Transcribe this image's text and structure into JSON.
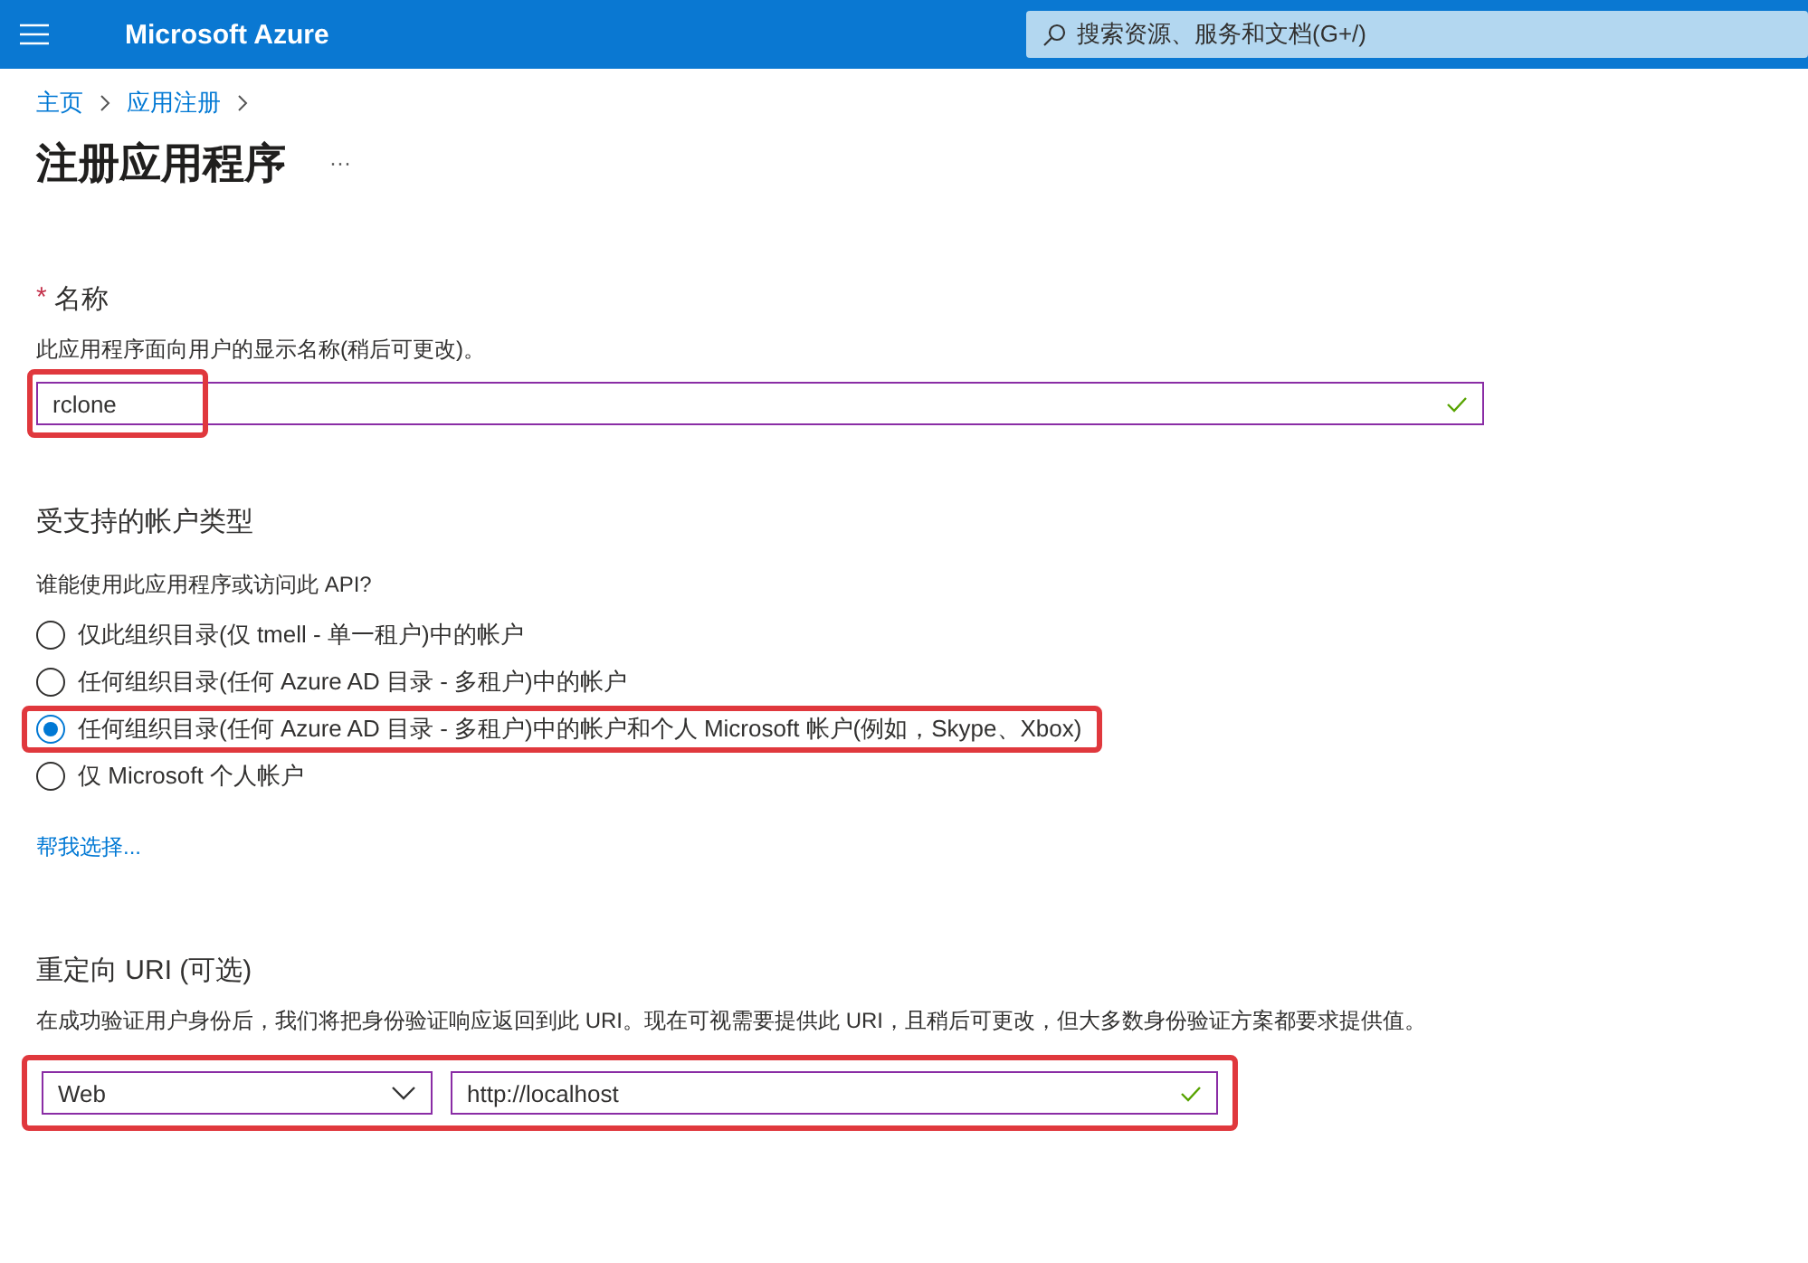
{
  "header": {
    "brand": "Microsoft Azure",
    "search": {
      "placeholder": "搜索资源、服务和文档(G+/)"
    }
  },
  "breadcrumb": [
    {
      "label": "主页"
    },
    {
      "label": "应用注册"
    }
  ],
  "page": {
    "title": "注册应用程序",
    "more": "···"
  },
  "name_section": {
    "required_mark": "*",
    "label": "名称",
    "description": "此应用程序面向用户的显示名称(稍后可更改)。",
    "field": {
      "value": "rclone",
      "valid": true,
      "highlighted": true
    }
  },
  "account_section": {
    "label": "受支持的帐户类型",
    "question": "谁能使用此应用程序或访问此 API?",
    "options": [
      {
        "label": "仅此组织目录(仅 tmell - 单一租户)中的帐户",
        "selected": false,
        "highlighted": false
      },
      {
        "label": "任何组织目录(任何 Azure AD 目录 - 多租户)中的帐户",
        "selected": false,
        "highlighted": false
      },
      {
        "label": "任何组织目录(任何 Azure AD 目录 - 多租户)中的帐户和个人 Microsoft 帐户(例如，Skype、Xbox)",
        "selected": true,
        "highlighted": true
      },
      {
        "label": "仅 Microsoft 个人帐户",
        "selected": false,
        "highlighted": false
      }
    ],
    "help_link": "帮我选择..."
  },
  "redirect_section": {
    "label": "重定向 URI (可选)",
    "description": "在成功验证用户身份后，我们将把身份验证响应返回到此 URI。现在可视需要提供此 URI，且稍后可更改，但大多数身份验证方案都要求提供值。",
    "highlighted": true,
    "platform": {
      "value": "Web"
    },
    "uri": {
      "value": "http://localhost",
      "valid": true
    }
  }
}
